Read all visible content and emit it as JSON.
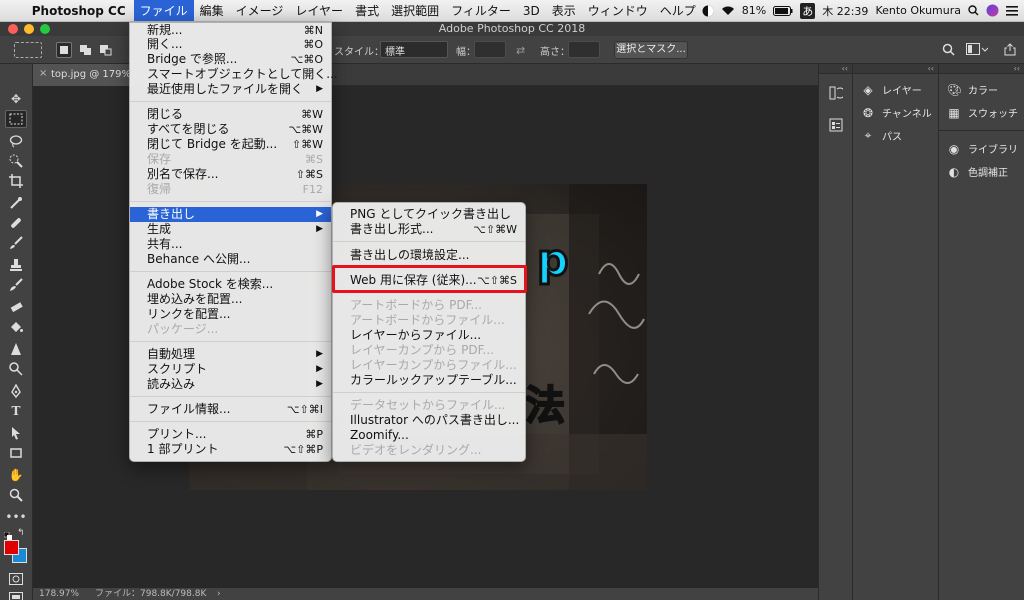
{
  "menubar": {
    "app": "Photoshop CC",
    "items": [
      "ファイル",
      "編集",
      "イメージ",
      "レイヤー",
      "書式",
      "選択範囲",
      "フィルター",
      "3D",
      "表示",
      "ウィンドウ",
      "ヘルプ"
    ],
    "battery": "81%",
    "input_method": "あ",
    "clock": "木 22:39",
    "user": "Kento Okumura"
  },
  "window": {
    "title": "Adobe Photoshop CC 2018"
  },
  "options": {
    "style_label": "スタイル：",
    "style_value": "標準",
    "width_label": "幅：",
    "height_label": "高さ：",
    "select_mask_button": "選択とマスク..."
  },
  "document": {
    "tab_title": "top.jpg @ 179% (",
    "zoom": "178.97%",
    "file_info": "ファイル：798.8K/798.8K",
    "overlay_text_1": "p",
    "overlay_text_2": "法"
  },
  "panels": {
    "col2": [
      "レイヤー",
      "チャンネル",
      "パス"
    ],
    "col3a": [
      "カラー",
      "スウォッチ"
    ],
    "col3b": [
      "ライブラリ",
      "色調補正"
    ]
  },
  "file_menu": {
    "items": [
      {
        "label": "新規...",
        "shortcut": "⌘N"
      },
      {
        "label": "開く...",
        "shortcut": "⌘O"
      },
      {
        "label": "Bridge で参照...",
        "shortcut": "⌥⌘O"
      },
      {
        "label": "スマートオブジェクトとして開く...",
        "shortcut": ""
      },
      {
        "label": "最近使用したファイルを開く",
        "shortcut": ""
      },
      {
        "label": "閉じる",
        "shortcut": "⌘W"
      },
      {
        "label": "すべてを閉じる",
        "shortcut": "⌥⌘W"
      },
      {
        "label": "閉じて Bridge を起動...",
        "shortcut": "⇧⌘W"
      },
      {
        "label": "保存",
        "shortcut": "⌘S"
      },
      {
        "label": "別名で保存...",
        "shortcut": "⇧⌘S"
      },
      {
        "label": "復帰",
        "shortcut": "F12"
      },
      {
        "label": "書き出し",
        "shortcut": ""
      },
      {
        "label": "生成",
        "shortcut": ""
      },
      {
        "label": "共有...",
        "shortcut": ""
      },
      {
        "label": "Behance へ公開...",
        "shortcut": ""
      },
      {
        "label": "Adobe Stock を検索...",
        "shortcut": ""
      },
      {
        "label": "埋め込みを配置...",
        "shortcut": ""
      },
      {
        "label": "リンクを配置...",
        "shortcut": ""
      },
      {
        "label": "パッケージ...",
        "shortcut": ""
      },
      {
        "label": "自動処理",
        "shortcut": ""
      },
      {
        "label": "スクリプト",
        "shortcut": ""
      },
      {
        "label": "読み込み",
        "shortcut": ""
      },
      {
        "label": "ファイル情報...",
        "shortcut": "⌥⇧⌘I"
      },
      {
        "label": "プリント...",
        "shortcut": "⌘P"
      },
      {
        "label": "1 部プリント",
        "shortcut": "⌥⇧⌘P"
      }
    ]
  },
  "export_submenu": {
    "items": [
      {
        "label": "PNG としてクイック書き出し",
        "shortcut": ""
      },
      {
        "label": "書き出し形式...",
        "shortcut": "⌥⇧⌘W"
      },
      {
        "label": "書き出しの環境設定...",
        "shortcut": ""
      },
      {
        "label": "Web 用に保存 (従来)...",
        "shortcut": "⌥⇧⌘S"
      },
      {
        "label": "アートボードから PDF...",
        "shortcut": ""
      },
      {
        "label": "アートボードからファイル...",
        "shortcut": ""
      },
      {
        "label": "レイヤーからファイル...",
        "shortcut": ""
      },
      {
        "label": "レイヤーカンプから PDF...",
        "shortcut": ""
      },
      {
        "label": "レイヤーカンプからファイル...",
        "shortcut": ""
      },
      {
        "label": "カラールックアップテーブル...",
        "shortcut": ""
      },
      {
        "label": "データセットからファイル...",
        "shortcut": ""
      },
      {
        "label": "Illustrator へのパス書き出し...",
        "shortcut": ""
      },
      {
        "label": "Zoomify...",
        "shortcut": ""
      },
      {
        "label": "ビデオをレンダリング...",
        "shortcut": ""
      }
    ]
  },
  "colors": {
    "menu_highlight": "#2a63d6",
    "callout_border": "#e6121c",
    "foreground_swatch": "#e00000",
    "background_swatch": "#1a8ad4"
  }
}
